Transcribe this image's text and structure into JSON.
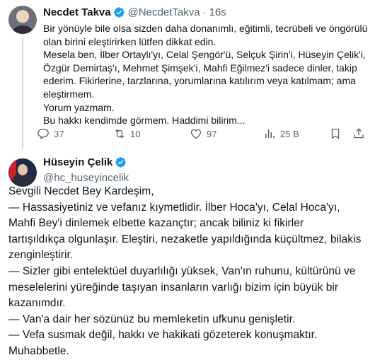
{
  "tweet1": {
    "author_name": "Necdet Takva",
    "handle": "@NecdetTakva",
    "separator": "·",
    "time": "16s",
    "text": "Bir yönüyle bile olsa sizden daha donanımlı, eğitimli, tecrübeli ve öngörülü\nolan birini eleştirirken lütfen dikkat edin.\nMesela ben, İlber Ortaylı'yı, Celal Şengör'ü, Selçuk Şirin'i, Hüseyin Çelik'i,\nÖzgür Demirtaş'ı, Mehmet Şimşek'i, Mahfi Eğilmez'i sadece dinler, takip\nederim. Fikirlerine, tarzlarına, yorumlarına katılırım veya katılmam; ama\neleştirmem.\nYorum yazmam.\nBu hakkı kendimde görmem. Haddimi bilirim...",
    "actions": {
      "replies": "37",
      "retweets": "10",
      "likes": "97",
      "views": "25 B"
    }
  },
  "tweet2": {
    "author_name": "Hüseyin Çelik",
    "handle": "@hc_huseyincelik",
    "text": "Sevgili Necdet Bey Kardeşim,\n— Hassasiyetiniz ve vefanız kıymetlidir. İlber Hoca'yı, Celal Hoca'yı,\nMahfi Bey'i dinlemek elbette kazançtır; ancak biliniz ki fikirler\ntartışıldıkça olgunlaşır. Eleştiri, nezaketle yapıldığında küçültmez, bilakis\nzenginleştirir.\n— Sizler gibi entelektüel duyarlılığı yüksek, Van'ın ruhunu, kültürünü ve\nmeselelerini yüreğinde taşıyan insanların varlığı bizim için büyük bir\nkazanımdır.\n— Van'a dair her sözünüz bu memleketin ufkunu genişletir.\n— Vefa susmak değil, hakkı ve hakikati gözeterek konuşmaktır.\nMuhabbetle."
  },
  "colors": {
    "verified": "#1d9bf0",
    "secondary_text": "#536471",
    "thread_line": "#cfd9de"
  },
  "icons": {
    "reply": "reply-icon",
    "retweet": "retweet-icon",
    "like": "heart-icon",
    "views": "views-icon",
    "bookmark": "bookmark-icon",
    "share": "share-icon"
  }
}
